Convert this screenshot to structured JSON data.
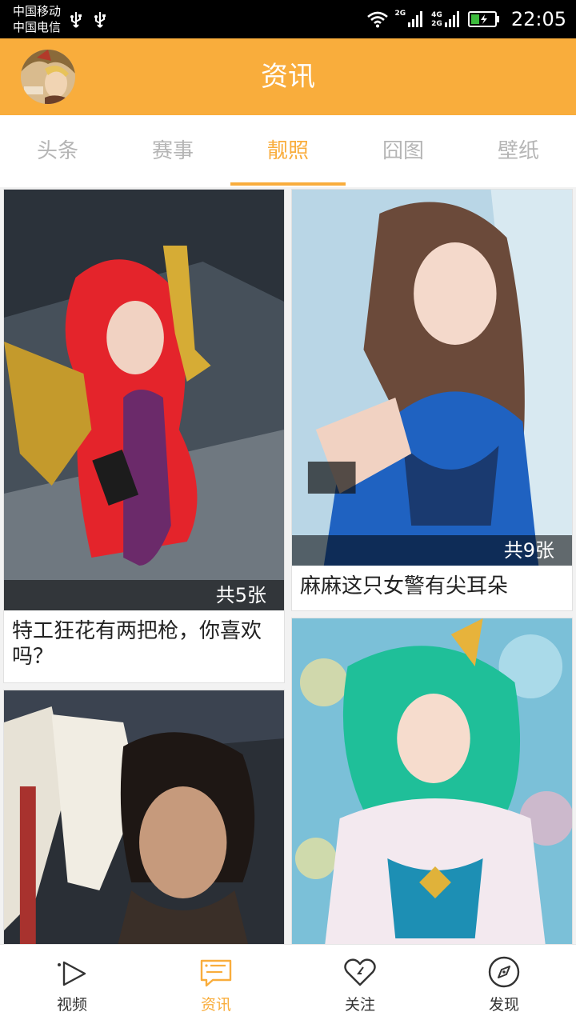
{
  "status_bar": {
    "carrier_1": "中国移动",
    "carrier_2": "中国电信",
    "net_1": "2G",
    "net_2a": "4G",
    "net_2b": "2G",
    "time": "22:05"
  },
  "app_bar": {
    "title": "资讯"
  },
  "tabs": [
    {
      "label": "头条"
    },
    {
      "label": "赛事"
    },
    {
      "label": "靓照",
      "selected": true
    },
    {
      "label": "囧图"
    },
    {
      "label": "壁纸"
    }
  ],
  "cards": [
    {
      "count": "共5张",
      "caption": "特工狂花有两把枪，你喜欢吗？"
    },
    {
      "count": "共9张",
      "caption": "麻麻这只女警有尖耳朵"
    },
    {
      "count": "",
      "caption": ""
    },
    {
      "count": "",
      "caption": ""
    }
  ],
  "bottom_nav": [
    {
      "label": "视频",
      "icon": "play-icon"
    },
    {
      "label": "资讯",
      "icon": "message-icon",
      "selected": true
    },
    {
      "label": "关注",
      "icon": "heart-icon"
    },
    {
      "label": "发现",
      "icon": "compass-icon"
    }
  ],
  "colors": {
    "accent": "#f9ad3c",
    "status_bar": "#000000",
    "battery": "#3dbb3d"
  }
}
